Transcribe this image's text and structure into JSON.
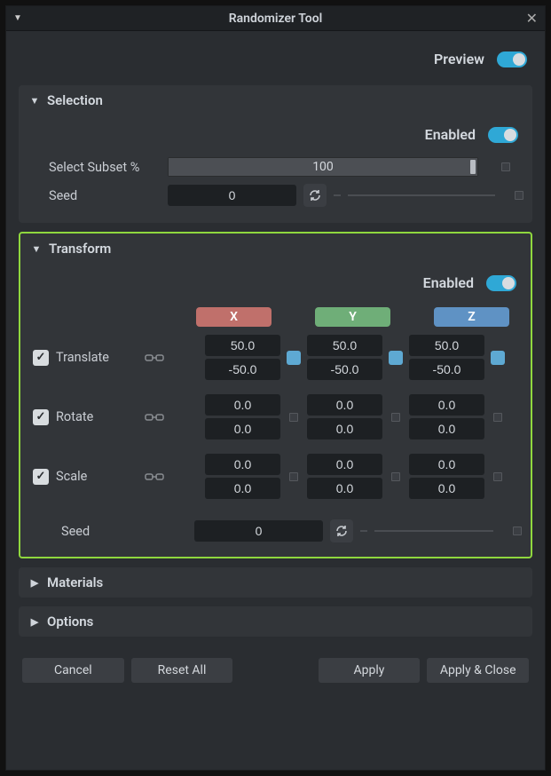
{
  "title": "Randomizer Tool",
  "preview_label": "Preview",
  "enabled_label": "Enabled",
  "sections": {
    "selection": {
      "title": "Selection",
      "subset_label": "Select Subset %",
      "subset_value": "100",
      "seed_label": "Seed",
      "seed_value": "0"
    },
    "transform": {
      "title": "Transform",
      "axes": {
        "x": "X",
        "y": "Y",
        "z": "Z"
      },
      "translate": {
        "label": "Translate",
        "x": {
          "hi": "50.0",
          "lo": "-50.0"
        },
        "y": {
          "hi": "50.0",
          "lo": "-50.0"
        },
        "z": {
          "hi": "50.0",
          "lo": "-50.0"
        }
      },
      "rotate": {
        "label": "Rotate",
        "x": {
          "hi": "0.0",
          "lo": "0.0"
        },
        "y": {
          "hi": "0.0",
          "lo": "0.0"
        },
        "z": {
          "hi": "0.0",
          "lo": "0.0"
        }
      },
      "scale": {
        "label": "Scale",
        "x": {
          "hi": "0.0",
          "lo": "0.0"
        },
        "y": {
          "hi": "0.0",
          "lo": "0.0"
        },
        "z": {
          "hi": "0.0",
          "lo": "0.0"
        }
      },
      "seed_label": "Seed",
      "seed_value": "0"
    },
    "materials": {
      "title": "Materials"
    },
    "options": {
      "title": "Options"
    }
  },
  "buttons": {
    "cancel": "Cancel",
    "reset_all": "Reset All",
    "apply": "Apply",
    "apply_close": "Apply & Close"
  }
}
